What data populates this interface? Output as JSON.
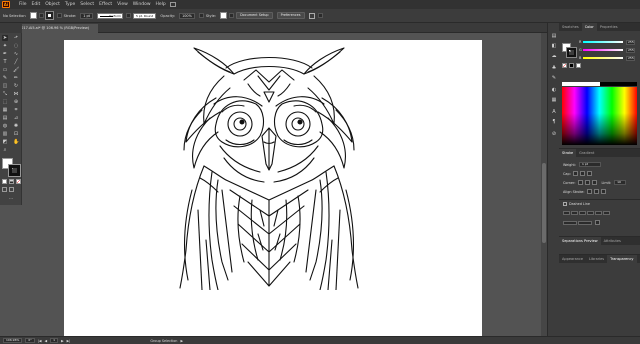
{
  "app": {
    "logo_text": "Ai"
  },
  "menu": [
    "File",
    "Edit",
    "Object",
    "Type",
    "Select",
    "Effect",
    "View",
    "Window",
    "Help"
  ],
  "control_bar": {
    "selection_label": "No Selection",
    "stroke_label": "Stroke:",
    "stroke_weight": "1 pt",
    "variable_width_label": "Uniform",
    "brush_label": "5 pt. Round",
    "opacity_label": "Opacity:",
    "opacity_value": "100%",
    "style_label": "Style:",
    "document_setup_label": "Document Setup",
    "preferences_label": "Preferences",
    "fill_color": "#ffffff",
    "stroke_color": "#111111"
  },
  "document_tab": {
    "close_glyph": "×",
    "title": "0017.Ai5.ai* @ 106.96 % (RGB/Preview)"
  },
  "color_panel": {
    "tabs": [
      "Swatches",
      "Color",
      "Properties"
    ],
    "active_tab": "Color",
    "sliders": [
      {
        "label": "R",
        "value": "255",
        "gradient": "linear-gradient(to right,#00ffff,#ffffff)"
      },
      {
        "label": "G",
        "value": "255",
        "gradient": "linear-gradient(to right,#ff00ff,#ffffff)"
      },
      {
        "label": "B",
        "value": "255",
        "gradient": "linear-gradient(to right,#ffff00,#ffffff)"
      }
    ]
  },
  "stroke_panel": {
    "tabs": [
      "Stroke",
      "Gradient"
    ],
    "weight_label": "Weight:",
    "weight_value": "1 pt",
    "cap_label": "Cap:",
    "corner_label": "Corner:",
    "limit_label": "Limit:",
    "limit_value": "10",
    "align_label": "Align Stroke:",
    "dashed_label": "Dashed Line"
  },
  "separations_panel": {
    "tabs": [
      "Separations Preview",
      "Attributes"
    ]
  },
  "appearance_panel": {
    "tabs": [
      "Appearance",
      "Libraries",
      "Transparency"
    ],
    "active_tab": "Transparency"
  },
  "status_bar": {
    "zoom": "106.96%",
    "angle": "0°",
    "artboard_number": "1",
    "tool_name": "Group Selection"
  }
}
